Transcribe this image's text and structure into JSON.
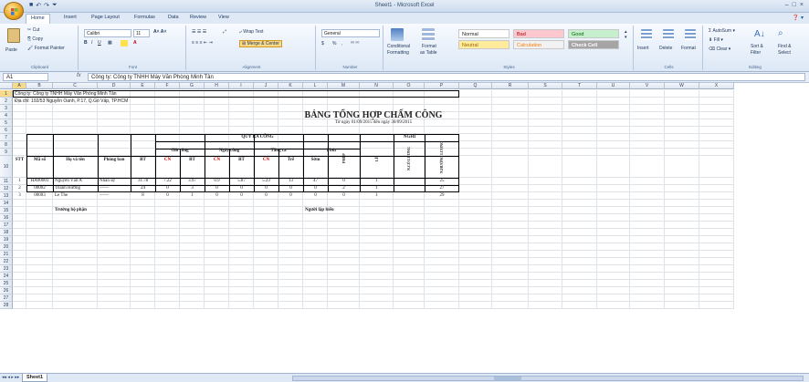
{
  "window": {
    "title": "Sheet1 - Microsoft Excel"
  },
  "tabs": [
    "Home",
    "Insert",
    "Page Layout",
    "Formulas",
    "Data",
    "Review",
    "View"
  ],
  "ribbon": {
    "clipboard": {
      "paste": "Paste",
      "cut": "Cut",
      "copy": "Copy",
      "format_painter": "Format Painter",
      "label": "Clipboard"
    },
    "font": {
      "name": "Calibri",
      "size": "11",
      "label": "Font"
    },
    "alignment": {
      "wrap": "Wrap Text",
      "merge": "Merge & Center",
      "label": "Alignment"
    },
    "number": {
      "format": "General",
      "currency": "$",
      "percent": "%",
      "comma": ",",
      "label": "Number"
    },
    "styles": {
      "cond": "Conditional",
      "cond2": "Formatting",
      "fmt_table": "Format",
      "fmt_table2": "as Table",
      "normal": "Normal",
      "bad": "Bad",
      "good": "Good",
      "neutral": "Neutral",
      "calculation": "Calculation",
      "check_cell": "Check Cell",
      "label": "Styles"
    },
    "cells": {
      "insert": "Insert",
      "delete": "Delete",
      "format": "Format",
      "label": "Cells"
    },
    "editing": {
      "autosum": "AutoSum",
      "fill": "Fill",
      "clear": "Clear",
      "sort": "Sort &",
      "sort2": "Filter",
      "find": "Find &",
      "find2": "Select",
      "label": "Editing"
    }
  },
  "formula_bar": {
    "name_box": "A1",
    "fx": "fx",
    "content": "Công ty: Công ty TNHH Máy Văn Phòng Minh Tân"
  },
  "columns": [
    "A",
    "B",
    "C",
    "D",
    "E",
    "F",
    "G",
    "H",
    "I",
    "J",
    "K",
    "L",
    "M",
    "N",
    "O",
    "P",
    "Q",
    "R",
    "S",
    "T",
    "U",
    "V",
    "W",
    "X"
  ],
  "rows": [
    "1",
    "2",
    "3",
    "4",
    "5",
    "6",
    "7",
    "8",
    "9",
    "10",
    "11",
    "12",
    "13",
    "14",
    "15",
    "16",
    "17",
    "18",
    "19",
    "20",
    "21",
    "22",
    "23",
    "24",
    "25",
    "26",
    "27",
    "28"
  ],
  "sheet": {
    "company": "Công ty: Công ty TNHH Máy Văn Phòng Minh Tân",
    "address": "Địa chỉ: 192/53 Nguyễn Oanh, P.17, Q.Gò Vấp, TP.HCM",
    "title": "BẢNG TỔNG HỢP CHẤM CÔNG",
    "subtitle": "Từ ngày 01/09/2015 đến ngày 30/09/2015",
    "quy_ra_cong": "QUY RA CÔNG",
    "nghi": "NGHỈ",
    "gio_cong": "Giờ công",
    "ngay_cong": "Ngày công",
    "tang_ca": "Tăng ca",
    "phut": "Phút",
    "headers": {
      "stt": "STT",
      "ma_so": "Mã số",
      "ho_ten": "Họ và tên",
      "phong_ban": "Phòng ban",
      "bt": "BT",
      "cn": "CN",
      "tre": "Trễ",
      "som": "Sớm",
      "phep": "PHÉP",
      "le": "LỄ",
      "ncl": "N.CÓ LƯƠNG",
      "nhl": "N.HƯỞNG LƯƠNG"
    },
    "data": [
      [
        "1",
        "HA00001",
        "Nguyễn Văn A",
        "Nhân sự",
        "31.78",
        "7.22",
        "3.97",
        "0.9",
        "5.87",
        "5.23",
        "13",
        "47",
        "0",
        "1",
        "",
        "25"
      ],
      [
        "2",
        "00002",
        "Thanh Hương",
        "——",
        "24",
        "0",
        "3",
        "0",
        "0",
        "0",
        "0",
        "0",
        "2",
        "1",
        "",
        "27"
      ],
      [
        "3",
        "00003",
        "Le The",
        "——",
        "8",
        "0",
        "1",
        "0",
        "0",
        "0",
        "0",
        "0",
        "0",
        "1",
        "",
        "29"
      ]
    ],
    "sign_left": "Trưởng bộ phận",
    "sign_right": "Người lập biểu"
  },
  "sheet_tab": "Sheet1"
}
